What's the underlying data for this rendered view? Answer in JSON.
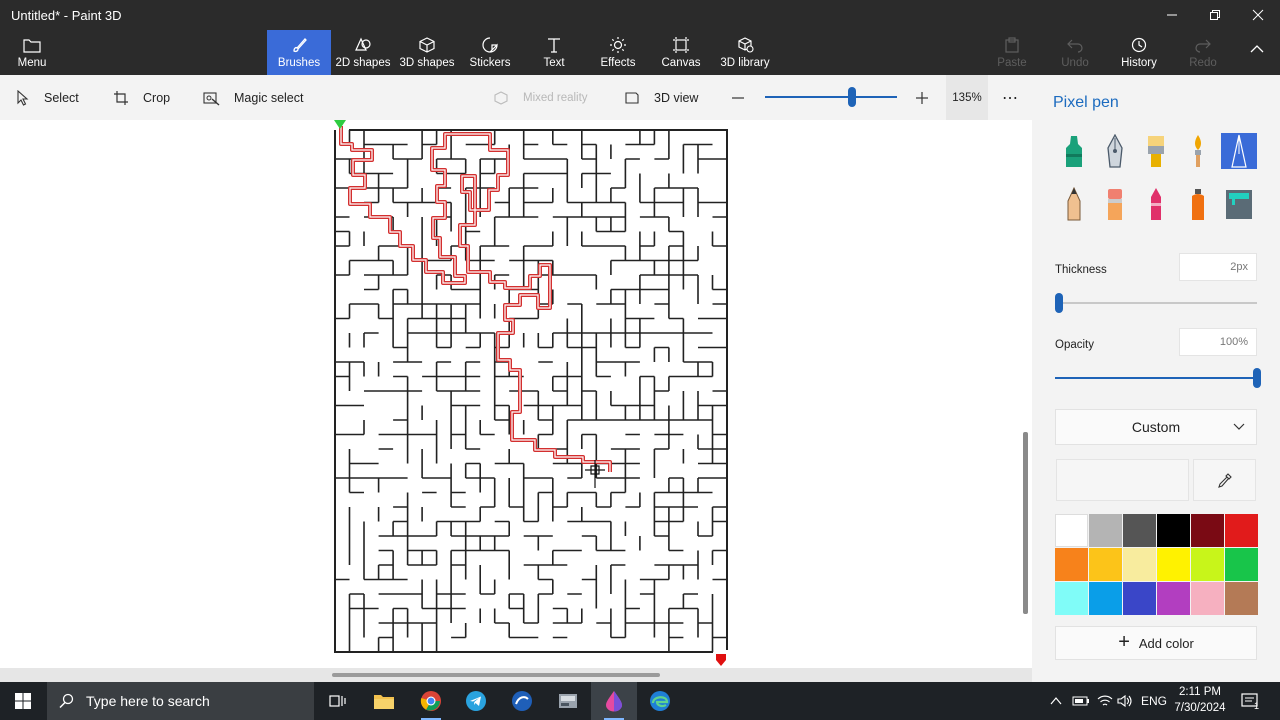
{
  "window": {
    "title": "Untitled* - Paint 3D",
    "controls": [
      "minimize",
      "maximize",
      "close"
    ]
  },
  "ribbon": {
    "menu_label": "Menu",
    "tools": [
      {
        "label": "Brushes",
        "icon": "brush-icon",
        "active": true
      },
      {
        "label": "2D shapes",
        "icon": "2d-shapes-icon"
      },
      {
        "label": "3D shapes",
        "icon": "cube-icon"
      },
      {
        "label": "Stickers",
        "icon": "sticker-icon"
      },
      {
        "label": "Text",
        "icon": "text-icon"
      },
      {
        "label": "Effects",
        "icon": "sun-icon"
      },
      {
        "label": "Canvas",
        "icon": "canvas-icon"
      },
      {
        "label": "3D library",
        "icon": "3d-library-icon"
      }
    ],
    "paste_label": "Paste",
    "undo_label": "Undo",
    "history_label": "History",
    "redo_label": "Redo"
  },
  "toolbar": {
    "select_label": "Select",
    "crop_label": "Crop",
    "magic_select_label": "Magic select",
    "mixed_reality_label": "Mixed reality",
    "view_3d_label": "3D view",
    "zoom_value": "135%",
    "zoom_level": 0.66
  },
  "canvas": {
    "content": "maze drawing with red solution path in progress",
    "path_color": "#d32f2f",
    "start_marker_color": "#2ecc40",
    "end_marker_color": "#e01010"
  },
  "panel": {
    "title": "Pixel pen",
    "brushes": [
      {
        "name": "marker",
        "color": "#1aa17a"
      },
      {
        "name": "calligraphy-pen",
        "color": "#5b6b7a"
      },
      {
        "name": "oil-brush",
        "color": "#e8b000"
      },
      {
        "name": "watercolor",
        "color": "#f0a500"
      },
      {
        "name": "pixel-pen",
        "color": "#3a6bd8",
        "selected": true
      },
      {
        "name": "pencil",
        "color": "#e0a060"
      },
      {
        "name": "eraser",
        "color": "#f08070"
      },
      {
        "name": "crayon",
        "color": "#e0306a"
      },
      {
        "name": "spray-can",
        "color": "#f07010"
      },
      {
        "name": "fill",
        "color": "#22a0a0"
      }
    ],
    "thickness_label": "Thickness",
    "thickness_value": "2px",
    "thickness_level": 0.02,
    "opacity_label": "Opacity",
    "opacity_value": "100%",
    "opacity_level": 1.0,
    "finish_label": "Custom",
    "palette": [
      "#ffffff",
      "#b4b4b4",
      "#555555",
      "#000000",
      "#7a0a14",
      "#e11b1b",
      "#f7821b",
      "#fcc419",
      "#f8ec9e",
      "#fff200",
      "#c8f51a",
      "#18c54a",
      "#80fcf8",
      "#0a9ee8",
      "#3a46c8",
      "#b23ec0",
      "#f6b0c0",
      "#b47a56"
    ],
    "add_color_label": "Add color"
  },
  "taskbar": {
    "search_placeholder": "Type here to search",
    "apps": [
      "task-view",
      "file-explorer",
      "chrome",
      "telegram",
      "app-blue",
      "app-storage",
      "paint-3d",
      "edge"
    ],
    "language": "ENG",
    "time": "2:11 PM",
    "date": "7/30/2024",
    "notification_count": "1"
  }
}
